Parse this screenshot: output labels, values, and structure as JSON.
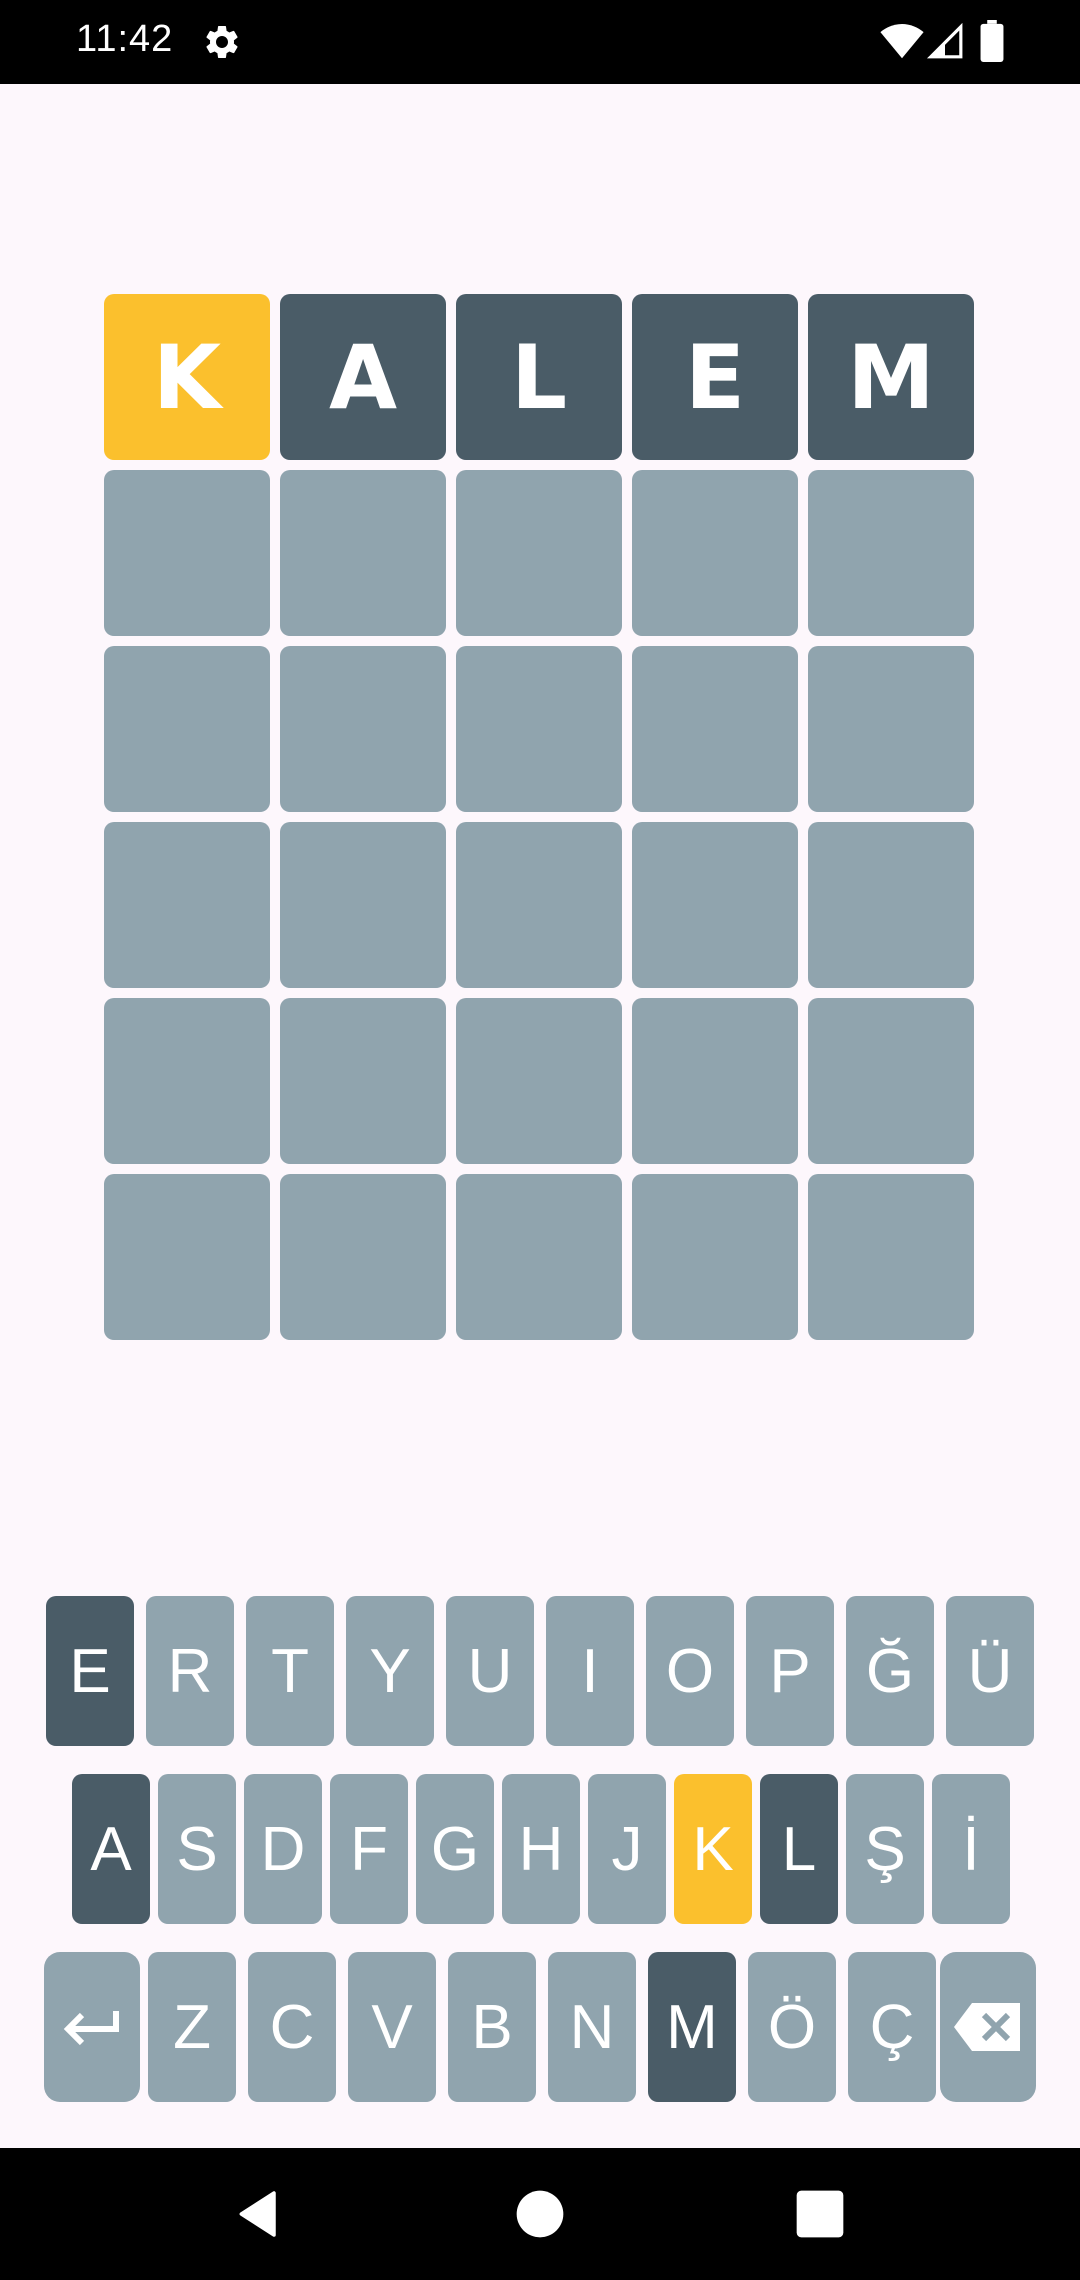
{
  "status_bar": {
    "time": "11:42",
    "icons": [
      "gear-icon",
      "wifi-icon",
      "signal-icon",
      "battery-icon"
    ]
  },
  "board": {
    "rows": [
      [
        {
          "letter": "K",
          "state": "present"
        },
        {
          "letter": "A",
          "state": "absent"
        },
        {
          "letter": "L",
          "state": "absent"
        },
        {
          "letter": "E",
          "state": "absent"
        },
        {
          "letter": "M",
          "state": "absent"
        }
      ],
      [
        {
          "letter": "",
          "state": "empty"
        },
        {
          "letter": "",
          "state": "empty"
        },
        {
          "letter": "",
          "state": "empty"
        },
        {
          "letter": "",
          "state": "empty"
        },
        {
          "letter": "",
          "state": "empty"
        }
      ],
      [
        {
          "letter": "",
          "state": "empty"
        },
        {
          "letter": "",
          "state": "empty"
        },
        {
          "letter": "",
          "state": "empty"
        },
        {
          "letter": "",
          "state": "empty"
        },
        {
          "letter": "",
          "state": "empty"
        }
      ],
      [
        {
          "letter": "",
          "state": "empty"
        },
        {
          "letter": "",
          "state": "empty"
        },
        {
          "letter": "",
          "state": "empty"
        },
        {
          "letter": "",
          "state": "empty"
        },
        {
          "letter": "",
          "state": "empty"
        }
      ],
      [
        {
          "letter": "",
          "state": "empty"
        },
        {
          "letter": "",
          "state": "empty"
        },
        {
          "letter": "",
          "state": "empty"
        },
        {
          "letter": "",
          "state": "empty"
        },
        {
          "letter": "",
          "state": "empty"
        }
      ],
      [
        {
          "letter": "",
          "state": "empty"
        },
        {
          "letter": "",
          "state": "empty"
        },
        {
          "letter": "",
          "state": "empty"
        },
        {
          "letter": "",
          "state": "empty"
        },
        {
          "letter": "",
          "state": "empty"
        }
      ]
    ]
  },
  "keyboard": {
    "rows": [
      [
        {
          "label": "E",
          "state": "absent"
        },
        {
          "label": "R",
          "state": "unused"
        },
        {
          "label": "T",
          "state": "unused"
        },
        {
          "label": "Y",
          "state": "unused"
        },
        {
          "label": "U",
          "state": "unused"
        },
        {
          "label": "I",
          "state": "unused"
        },
        {
          "label": "O",
          "state": "unused"
        },
        {
          "label": "P",
          "state": "unused"
        },
        {
          "label": "Ğ",
          "state": "unused"
        },
        {
          "label": "Ü",
          "state": "unused"
        }
      ],
      [
        {
          "label": "A",
          "state": "absent"
        },
        {
          "label": "S",
          "state": "unused"
        },
        {
          "label": "D",
          "state": "unused"
        },
        {
          "label": "F",
          "state": "unused"
        },
        {
          "label": "G",
          "state": "unused"
        },
        {
          "label": "H",
          "state": "unused"
        },
        {
          "label": "J",
          "state": "unused"
        },
        {
          "label": "K",
          "state": "present"
        },
        {
          "label": "L",
          "state": "absent"
        },
        {
          "label": "Ş",
          "state": "unused"
        },
        {
          "label": "İ",
          "state": "unused"
        }
      ],
      [
        {
          "label": "",
          "state": "unused",
          "icon": "enter-icon"
        },
        {
          "label": "Z",
          "state": "unused"
        },
        {
          "label": "C",
          "state": "unused"
        },
        {
          "label": "V",
          "state": "unused"
        },
        {
          "label": "B",
          "state": "unused"
        },
        {
          "label": "N",
          "state": "unused"
        },
        {
          "label": "M",
          "state": "absent"
        },
        {
          "label": "Ö",
          "state": "unused"
        },
        {
          "label": "Ç",
          "state": "unused"
        },
        {
          "label": "",
          "state": "unused",
          "icon": "backspace-icon"
        }
      ]
    ]
  },
  "nav_bar": {
    "icons": [
      "back-icon",
      "home-icon",
      "recents-icon"
    ]
  },
  "colors": {
    "present": "#fbc02d",
    "absent": "#4a5c67",
    "empty": "#90a4ae",
    "background": "#fdf7fc"
  }
}
